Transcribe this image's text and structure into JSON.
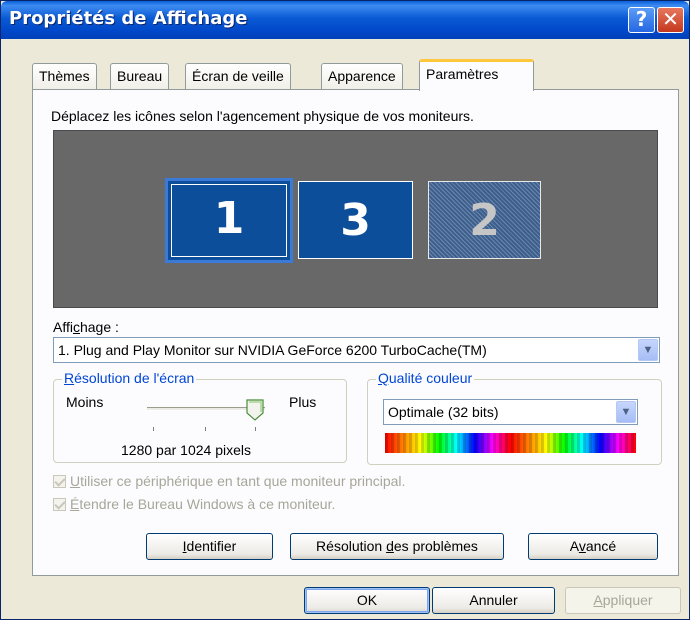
{
  "window": {
    "title": "Propriétés de Affichage",
    "help_glyph": "?",
    "close_glyph": "✕"
  },
  "tabs": [
    {
      "label": "Thèmes"
    },
    {
      "label": "Bureau"
    },
    {
      "label": "Écran de veille"
    },
    {
      "label": "Apparence"
    },
    {
      "label": "Paramètres",
      "active": true
    }
  ],
  "main": {
    "instruction": "Déplacez les icônes selon l'agencement physique de vos moniteurs.",
    "monitors": [
      {
        "number": "1",
        "selected": true
      },
      {
        "number": "3"
      },
      {
        "number": "2",
        "disabled": true
      }
    ],
    "display_label": {
      "pre": "Affi",
      "accel": "c",
      "post": "hage :"
    },
    "display_value": "1. Plug and Play Monitor sur NVIDIA GeForce 6200 TurboCache(TM)",
    "resolution": {
      "title_accel": "R",
      "title_rest": "ésolution de l'écran",
      "less": "Moins",
      "more": "Plus",
      "value": "1280 par 1024 pixels"
    },
    "color_quality": {
      "title_accel": "Q",
      "title_rest": "ualité couleur",
      "value": "Optimale (32 bits)"
    },
    "checkbox_primary": {
      "accel": "U",
      "rest": "tiliser ce périphérique en tant que moniteur principal.",
      "checked": true
    },
    "checkbox_extend": {
      "accel": "É",
      "rest": "tendre le Bureau Windows à ce moniteur.",
      "checked": true
    }
  },
  "buttons": {
    "identify": {
      "accel": "I",
      "rest": "dentifier"
    },
    "troubleshoot": {
      "pre": "Résolution ",
      "accel": "d",
      "post": "es problèmes"
    },
    "advanced": {
      "pre": "A",
      "accel": "v",
      "post": "ancé"
    },
    "ok": "OK",
    "cancel": "Annuler",
    "apply": {
      "accel": "A",
      "rest": "ppliquer"
    }
  },
  "colors": {
    "title_bar": "#0a5ad4",
    "monitor_selected": "#0c4e9a",
    "monitor_area": "#686868",
    "group_title": "#0046d5",
    "disabled_text": "#a6a69a"
  }
}
